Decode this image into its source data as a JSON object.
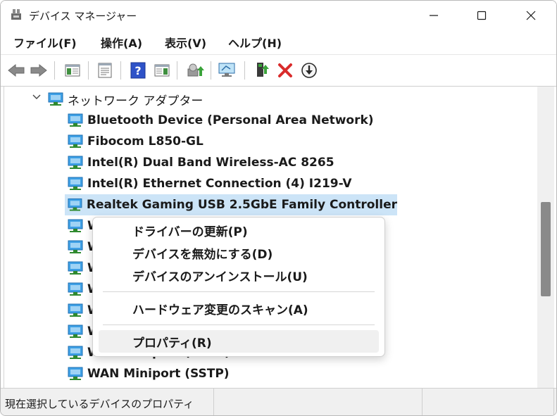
{
  "window": {
    "title": "デバイス マネージャー"
  },
  "menubar": {
    "items": [
      "ファイル(F)",
      "操作(A)",
      "表示(V)",
      "ヘルプ(H)"
    ]
  },
  "toolbar": {
    "buttons": [
      "back-arrow-icon",
      "forward-arrow-icon",
      "show-hide-tree-icon",
      "properties-icon",
      "help-icon",
      "action-pane-icon",
      "update-driver-icon",
      "scan-hardware-icon",
      "enable-device-icon",
      "uninstall-device-icon",
      "download-driver-icon"
    ]
  },
  "tree": {
    "category": "ネットワーク アダプター",
    "devices": [
      "Bluetooth Device (Personal Area Network)",
      "Fibocom L850-GL",
      "Intel(R) Dual Band Wireless-AC 8265",
      "Intel(R) Ethernet Connection (4) I219-V",
      "Realtek Gaming USB 2.5GbE Family Controller",
      "W",
      "W",
      "W",
      "W",
      "W",
      "W",
      "WAN Miniport (PPTP)",
      "WAN Miniport (SSTP)"
    ],
    "selected_index": 4
  },
  "context_menu": {
    "items": [
      "ドライバーの更新(P)",
      "デバイスを無効にする(D)",
      "デバイスのアンインストール(U)",
      "ハードウェア変更のスキャン(A)",
      "プロパティ(R)"
    ],
    "hovered_index": 4
  },
  "statusbar": {
    "text": "現在選択しているデバイスのプロパティ"
  },
  "colors": {
    "selection": "#cce4f7",
    "accent_red": "#d92b2b",
    "icon_blue": "#1f7fd1"
  }
}
